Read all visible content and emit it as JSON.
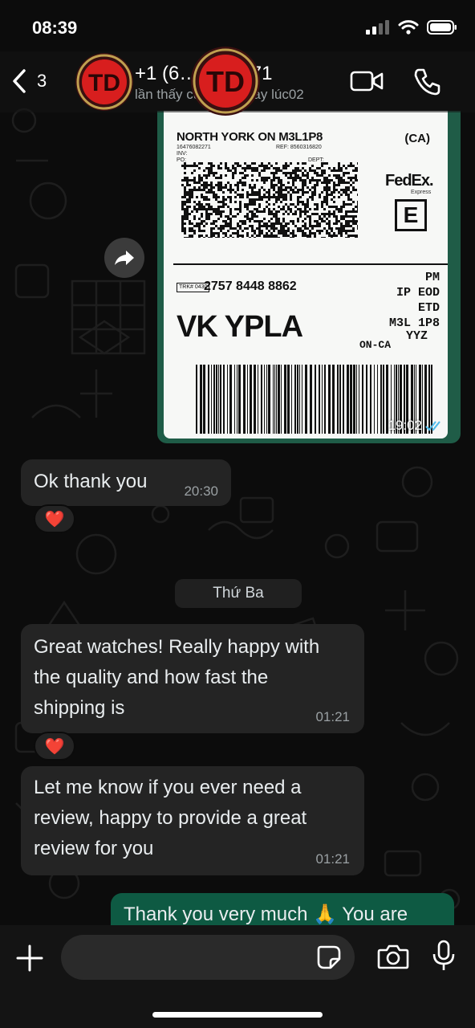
{
  "status_bar": {
    "time": "08:39"
  },
  "header": {
    "back_count": "3",
    "contact_name": "+1 (6… …-2271",
    "contact_status": "lần thấy cuối hôm nay lúc02",
    "logo_text": "TD"
  },
  "messages": {
    "label_image": {
      "city_line": "NORTH YORK ON M3L1P8",
      "country": "(CA)",
      "phone": "16476082271",
      "ref": "REF: 8560316820",
      "inv": "INV:",
      "po": "PO:",
      "dept": "DEPT:",
      "carrier": "FedEx.",
      "service": "Express",
      "service_letter": "E",
      "trk_box": "TRK# 0430",
      "tracking_number": "2757 8448 8862",
      "route_lines": [
        "PM",
        "IP EOD",
        "ETD",
        "M3L 1P8"
      ],
      "destination_code": "VK YPLA",
      "on_ca": "ON-CA",
      "airport": "YYZ",
      "time": "19:02"
    },
    "ok_thank_you": {
      "text": "Ok thank you",
      "time": "20:30",
      "reaction": "❤️"
    },
    "date_divider": "Thứ Ba",
    "great_watches": {
      "lines": [
        "Great watches! Really happy with",
        "the quality and how fast the",
        "shipping is"
      ],
      "time": "01:21",
      "reaction": "❤️"
    },
    "review": {
      "lines": [
        "Let me know if you ever need a",
        "review, happy to provide a great",
        "review for you"
      ],
      "time": "01:21"
    },
    "outgoing": {
      "text": "Thank you very much 🙏 You are"
    }
  },
  "input": {
    "placeholder": "",
    "value": ""
  },
  "colors": {
    "incoming_bubble": "#242424",
    "outgoing_bubble": "#0e5a43",
    "heart": "#e0243a",
    "logo_red": "#d81e1e",
    "read_tick": "#53bdeb"
  }
}
